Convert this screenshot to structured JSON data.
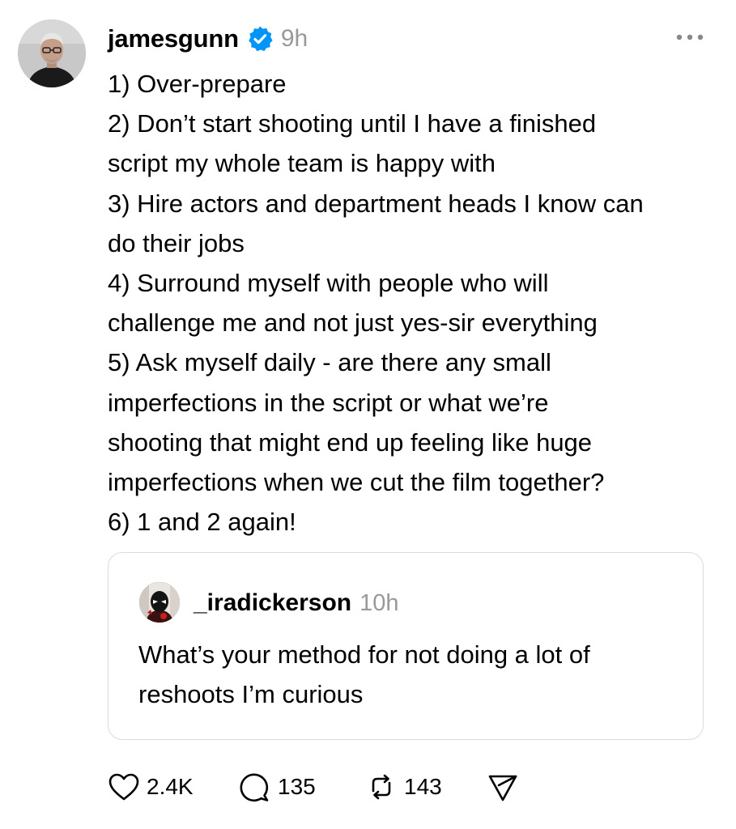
{
  "post": {
    "author": {
      "username": "jamesgunn",
      "verified": true,
      "avatar_icon": "profile-photo"
    },
    "time": "9h",
    "more_icon": "more-horizontal-icon",
    "lines": [
      "1) Over-prepare",
      "2) Don’t start shooting until I have a finished",
      "script my whole team is happy with",
      "3) Hire actors and department heads I know can",
      "do their jobs",
      "4) Surround myself with people who will",
      "challenge me and not just yes-sir everything",
      "5) Ask myself daily - are there any small",
      "imperfections in the script or what we’re",
      "shooting that might end up feeling like huge",
      "imperfections when we cut the film together?",
      "6) 1 and 2 again!"
    ]
  },
  "quote": {
    "username": "_iradickerson",
    "time": "10h",
    "lines": [
      "What’s your method for not doing a lot of",
      "reshoots I’m curious"
    ]
  },
  "actions": {
    "likes": "2.4K",
    "replies": "135",
    "reposts": "143",
    "icons": [
      "heart-icon",
      "comment-icon",
      "repost-icon",
      "share-icon"
    ]
  },
  "colors": {
    "text": "#000000",
    "muted": "#999999",
    "verified": "#0095f6",
    "border": "#dcdcdc"
  }
}
